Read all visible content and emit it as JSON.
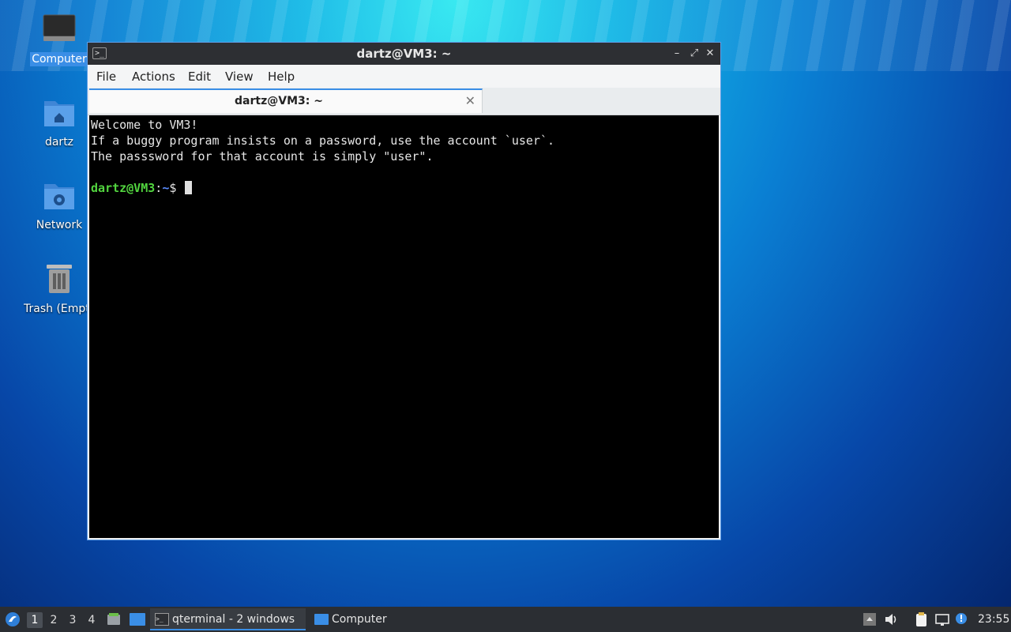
{
  "desktop": {
    "icons": [
      {
        "label": "Computer"
      },
      {
        "label": "dartz"
      },
      {
        "label": "Network"
      },
      {
        "label": "Trash (Empty)"
      }
    ]
  },
  "window": {
    "title": "dartz@VM3: ~",
    "menu": [
      "File",
      "Actions",
      "Edit",
      "View",
      "Help"
    ],
    "tab": {
      "label": "dartz@VM3: ~"
    },
    "terminal": {
      "lines": [
        "Welcome to VM3!",
        "If a buggy program insists on a password, use the account `user`.",
        "The passsword for that account is simply \"user\"."
      ],
      "prompt_user": "dartz@VM3",
      "prompt_sep": ":",
      "prompt_path": "~",
      "prompt_symbol": "$"
    }
  },
  "taskbar": {
    "workspaces": [
      "1",
      "2",
      "3",
      "4"
    ],
    "active_workspace": "1",
    "tasks": [
      {
        "label": "qterminal - 2 windows"
      },
      {
        "label": "Computer"
      }
    ],
    "clock": "23:55"
  },
  "colors": {
    "accent": "#3a8ee6",
    "prompt_user": "#52d43f",
    "prompt_path": "#5a8cff"
  }
}
